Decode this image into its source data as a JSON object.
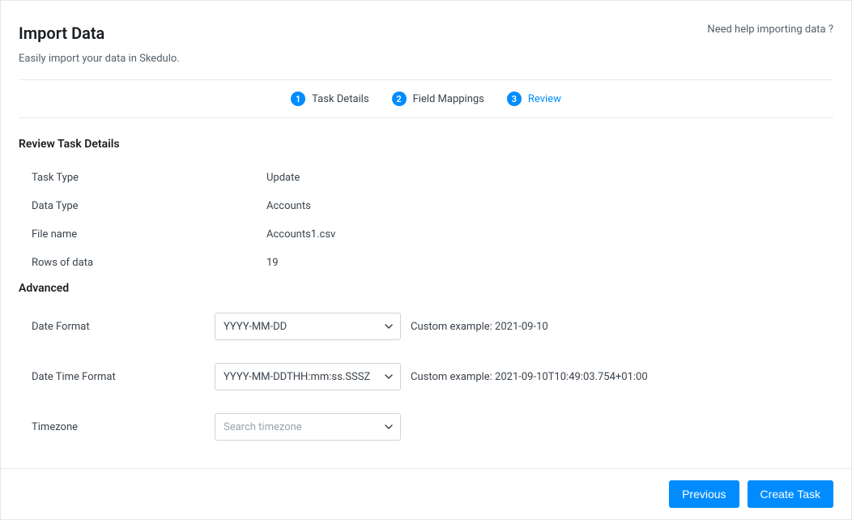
{
  "header": {
    "title": "Import Data",
    "subtitle": "Easily import your data in Skedulo.",
    "help_link": "Need help importing data ?"
  },
  "stepper": {
    "steps": [
      {
        "num": "1",
        "label": "Task Details",
        "active": false
      },
      {
        "num": "2",
        "label": "Field Mappings",
        "active": false
      },
      {
        "num": "3",
        "label": "Review",
        "active": true
      }
    ]
  },
  "review": {
    "heading": "Review Task Details",
    "rows": [
      {
        "label": "Task Type",
        "value": "Update"
      },
      {
        "label": "Data Type",
        "value": "Accounts"
      },
      {
        "label": "File name",
        "value": "Accounts1.csv"
      },
      {
        "label": "Rows of data",
        "value": "19"
      }
    ]
  },
  "advanced": {
    "heading": "Advanced",
    "date_format": {
      "label": "Date Format",
      "value": "YYYY-MM-DD",
      "example": "Custom example: 2021-09-10"
    },
    "datetime_format": {
      "label": "Date Time Format",
      "value": "YYYY-MM-DDTHH:mm:ss.SSSZ",
      "example": "Custom example: 2021-09-10T10:49:03.754+01:00"
    },
    "timezone": {
      "label": "Timezone",
      "placeholder": "Search timezone"
    }
  },
  "footer": {
    "previous": "Previous",
    "create": "Create Task"
  }
}
